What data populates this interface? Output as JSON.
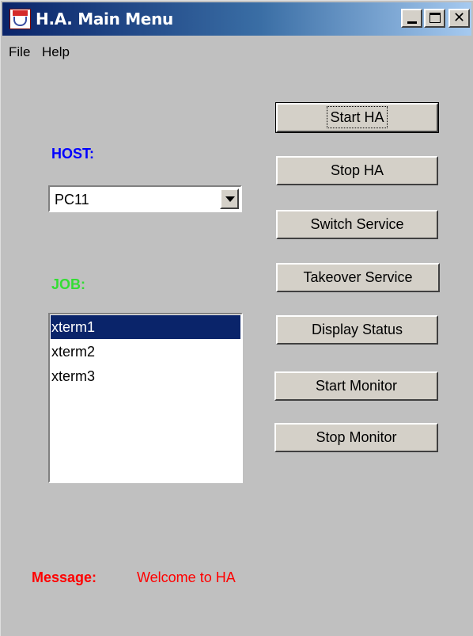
{
  "window": {
    "title": "H.A. Main Menu",
    "controls": {
      "minimize": "_",
      "maximize": "□",
      "close": "✕"
    }
  },
  "menubar": {
    "items": [
      {
        "label": "File"
      },
      {
        "label": "Help"
      }
    ]
  },
  "host": {
    "label": "HOST:",
    "selected": "PC11",
    "color": "#0000ff"
  },
  "job": {
    "label": "JOB:",
    "color": "#33dd33",
    "items": [
      {
        "label": "xterm1",
        "selected": true
      },
      {
        "label": "xterm2",
        "selected": false
      },
      {
        "label": "xterm3",
        "selected": false
      }
    ]
  },
  "actions": {
    "start_ha": "Start HA",
    "stop_ha": "Stop HA",
    "switch_service": "Switch Service",
    "takeover_service": "Takeover Service",
    "display_status": "Display Status",
    "start_monitor": "Start Monitor",
    "stop_monitor": "Stop Monitor"
  },
  "message": {
    "label": "Message:",
    "text": "Welcome to HA",
    "color": "#ff0000"
  },
  "colors": {
    "window_bg": "#c0c0c0",
    "titlebar_start": "#0a246a",
    "titlebar_end": "#a6caf0",
    "selection": "#0a246a"
  },
  "icons": {
    "app": "java-coffee-cup-icon",
    "dropdown": "chevron-down-icon"
  }
}
